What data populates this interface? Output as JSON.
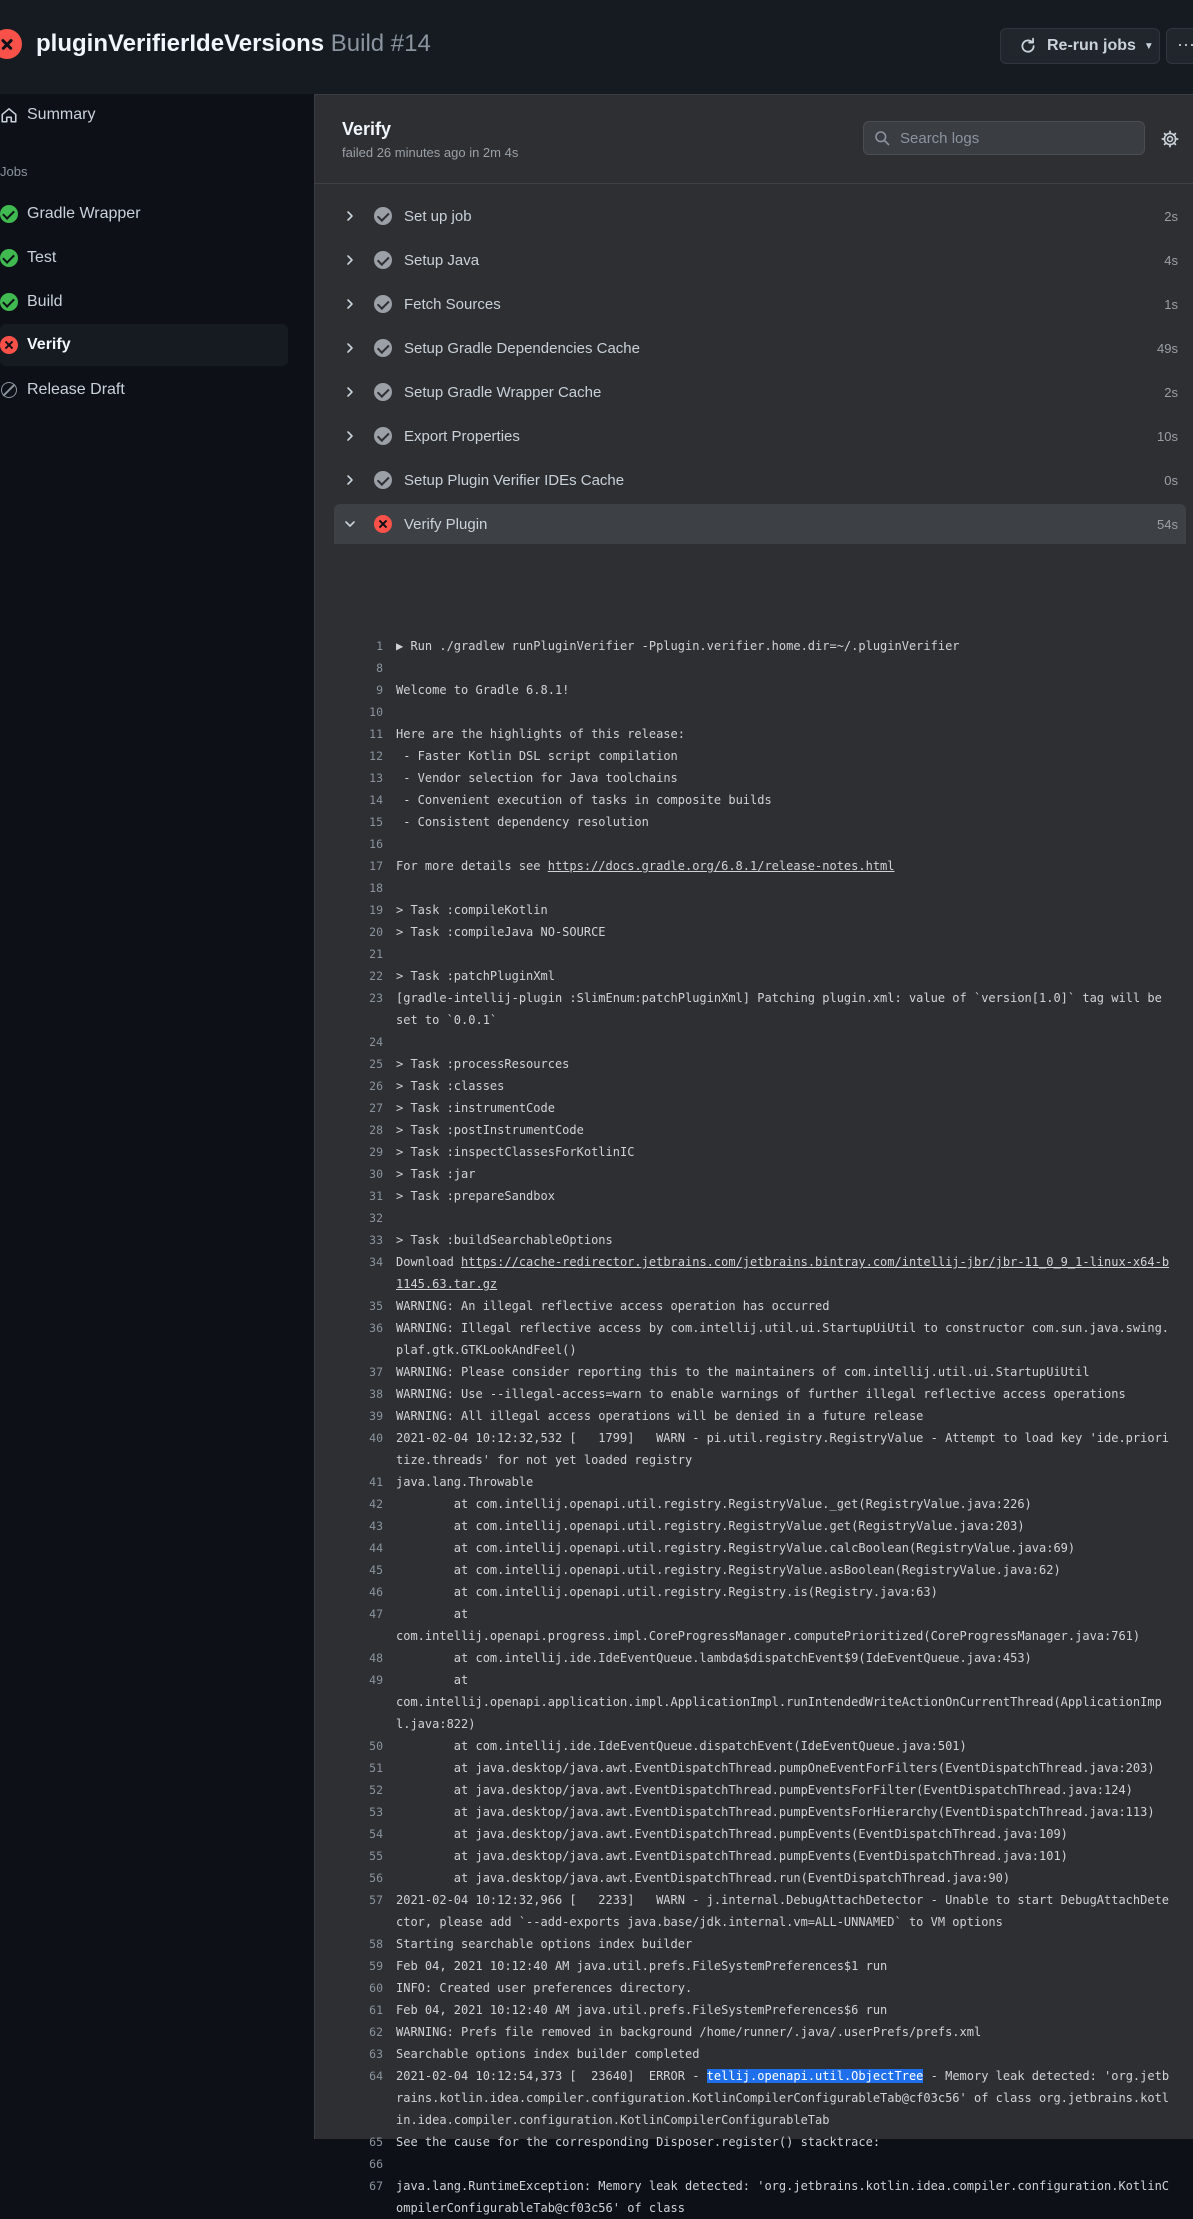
{
  "header": {
    "workflow": "pluginVerifierIdeVersions",
    "build": "Build #14",
    "rerun_label": "Re-run jobs",
    "more_label": "···"
  },
  "sidebar": {
    "summary_label": "Summary",
    "jobs_label": "Jobs",
    "jobs": [
      {
        "label": "Gradle Wrapper",
        "status": "success"
      },
      {
        "label": "Test",
        "status": "success"
      },
      {
        "label": "Build",
        "status": "success"
      },
      {
        "label": "Verify",
        "status": "failure"
      },
      {
        "label": "Release Draft",
        "status": "skipped"
      }
    ]
  },
  "job": {
    "name": "Verify",
    "status_text": "failed 26 minutes ago in 2m 4s",
    "search_placeholder": "Search logs"
  },
  "steps": [
    {
      "name": "Set up job",
      "duration": "2s"
    },
    {
      "name": "Setup Java",
      "duration": "4s"
    },
    {
      "name": "Fetch Sources",
      "duration": "1s"
    },
    {
      "name": "Setup Gradle Dependencies Cache",
      "duration": "49s"
    },
    {
      "name": "Setup Gradle Wrapper Cache",
      "duration": "2s"
    },
    {
      "name": "Export Properties",
      "duration": "10s"
    },
    {
      "name": "Setup Plugin Verifier IDEs Cache",
      "duration": "0s"
    },
    {
      "name": "Verify Plugin",
      "duration": "54s"
    }
  ],
  "log": [
    {
      "n": "1",
      "t": "▶ Run ./gradlew runPluginVerifier -Pplugin.verifier.home.dir=~/.pluginVerifier"
    },
    {
      "n": "8",
      "t": ""
    },
    {
      "n": "9",
      "t": "Welcome to Gradle 6.8.1!"
    },
    {
      "n": "10",
      "t": ""
    },
    {
      "n": "11",
      "t": "Here are the highlights of this release:"
    },
    {
      "n": "12",
      "t": " - Faster Kotlin DSL script compilation"
    },
    {
      "n": "13",
      "t": " - Vendor selection for Java toolchains"
    },
    {
      "n": "14",
      "t": " - Convenient execution of tasks in composite builds"
    },
    {
      "n": "15",
      "t": " - Consistent dependency resolution"
    },
    {
      "n": "16",
      "t": ""
    },
    {
      "n": "17",
      "t": "For more details see ",
      "link": "https://docs.gradle.org/6.8.1/release-notes.html"
    },
    {
      "n": "18",
      "t": ""
    },
    {
      "n": "19",
      "t": "> Task :compileKotlin"
    },
    {
      "n": "20",
      "t": "> Task :compileJava NO-SOURCE"
    },
    {
      "n": "21",
      "t": ""
    },
    {
      "n": "22",
      "t": "> Task :patchPluginXml"
    },
    {
      "n": "23",
      "t": "[gradle-intellij-plugin :SlimEnum:patchPluginXml] Patching plugin.xml: value of `version[1.0]` tag will be set to `0.0.1`"
    },
    {
      "n": "24",
      "t": ""
    },
    {
      "n": "25",
      "t": "> Task :processResources"
    },
    {
      "n": "26",
      "t": "> Task :classes"
    },
    {
      "n": "27",
      "t": "> Task :instrumentCode"
    },
    {
      "n": "28",
      "t": "> Task :postInstrumentCode"
    },
    {
      "n": "29",
      "t": "> Task :inspectClassesForKotlinIC"
    },
    {
      "n": "30",
      "t": "> Task :jar"
    },
    {
      "n": "31",
      "t": "> Task :prepareSandbox"
    },
    {
      "n": "32",
      "t": ""
    },
    {
      "n": "33",
      "t": "> Task :buildSearchableOptions"
    },
    {
      "n": "34",
      "t": "Download ",
      "link": "https://cache-redirector.jetbrains.com/jetbrains.bintray.com/intellij-jbr/jbr-11_0_9_1-linux-x64-b1145.63.tar.gz"
    },
    {
      "n": "35",
      "t": "WARNING: An illegal reflective access operation has occurred"
    },
    {
      "n": "36",
      "t": "WARNING: Illegal reflective access by com.intellij.util.ui.StartupUiUtil to constructor com.sun.java.swing.plaf.gtk.GTKLookAndFeel()"
    },
    {
      "n": "37",
      "t": "WARNING: Please consider reporting this to the maintainers of com.intellij.util.ui.StartupUiUtil"
    },
    {
      "n": "38",
      "t": "WARNING: Use --illegal-access=warn to enable warnings of further illegal reflective access operations"
    },
    {
      "n": "39",
      "t": "WARNING: All illegal access operations will be denied in a future release"
    },
    {
      "n": "40",
      "t": "2021-02-04 10:12:32,532 [   1799]   WARN - pi.util.registry.RegistryValue - Attempt to load key 'ide.prioritize.threads' for not yet loaded registry"
    },
    {
      "n": "41",
      "t": "java.lang.Throwable"
    },
    {
      "n": "42",
      "t": "        at com.intellij.openapi.util.registry.RegistryValue._get(RegistryValue.java:226)"
    },
    {
      "n": "43",
      "t": "        at com.intellij.openapi.util.registry.RegistryValue.get(RegistryValue.java:203)"
    },
    {
      "n": "44",
      "t": "        at com.intellij.openapi.util.registry.RegistryValue.calcBoolean(RegistryValue.java:69)"
    },
    {
      "n": "45",
      "t": "        at com.intellij.openapi.util.registry.RegistryValue.asBoolean(RegistryValue.java:62)"
    },
    {
      "n": "46",
      "t": "        at com.intellij.openapi.util.registry.Registry.is(Registry.java:63)"
    },
    {
      "n": "47",
      "t": "        at\ncom.intellij.openapi.progress.impl.CoreProgressManager.computePrioritized(CoreProgressManager.java:761)"
    },
    {
      "n": "48",
      "t": "        at com.intellij.ide.IdeEventQueue.lambda$dispatchEvent$9(IdeEventQueue.java:453)"
    },
    {
      "n": "49",
      "t": "        at\ncom.intellij.openapi.application.impl.ApplicationImpl.runIntendedWriteActionOnCurrentThread(ApplicationImpl.java:822)"
    },
    {
      "n": "50",
      "t": "        at com.intellij.ide.IdeEventQueue.dispatchEvent(IdeEventQueue.java:501)"
    },
    {
      "n": "51",
      "t": "        at java.desktop/java.awt.EventDispatchThread.pumpOneEventForFilters(EventDispatchThread.java:203)"
    },
    {
      "n": "52",
      "t": "        at java.desktop/java.awt.EventDispatchThread.pumpEventsForFilter(EventDispatchThread.java:124)"
    },
    {
      "n": "53",
      "t": "        at java.desktop/java.awt.EventDispatchThread.pumpEventsForHierarchy(EventDispatchThread.java:113)"
    },
    {
      "n": "54",
      "t": "        at java.desktop/java.awt.EventDispatchThread.pumpEvents(EventDispatchThread.java:109)"
    },
    {
      "n": "55",
      "t": "        at java.desktop/java.awt.EventDispatchThread.pumpEvents(EventDispatchThread.java:101)"
    },
    {
      "n": "56",
      "t": "        at java.desktop/java.awt.EventDispatchThread.run(EventDispatchThread.java:90)"
    },
    {
      "n": "57",
      "t": "2021-02-04 10:12:32,966 [   2233]   WARN - j.internal.DebugAttachDetector - Unable to start DebugAttachDetector, please add `--add-exports java.base/jdk.internal.vm=ALL-UNNAMED` to VM options"
    },
    {
      "n": "58",
      "t": "Starting searchable options index builder"
    },
    {
      "n": "59",
      "t": "Feb 04, 2021 10:12:40 AM java.util.prefs.FileSystemPreferences$1 run"
    },
    {
      "n": "60",
      "t": "INFO: Created user preferences directory."
    },
    {
      "n": "61",
      "t": "Feb 04, 2021 10:12:40 AM java.util.prefs.FileSystemPreferences$6 run"
    },
    {
      "n": "62",
      "t": "WARNING: Prefs file removed in background /home/runner/.java/.userPrefs/prefs.xml"
    },
    {
      "n": "63",
      "t": "Searchable options index builder completed"
    },
    {
      "n": "64",
      "pre": "2021-02-04 10:12:54,373 [  23640]  ERROR - ",
      "hl": "tellij.openapi.util.ObjectTree",
      "t": " - Memory leak detected: 'org.jetbrains.kotlin.idea.compiler.configuration.KotlinCompilerConfigurableTab@cf03c56' of class org.jetbrains.kotlin.idea.compiler.configuration.KotlinCompilerConfigurableTab"
    },
    {
      "n": "65",
      "t": "See the cause for the corresponding Disposer.register() stacktrace:"
    },
    {
      "n": "66",
      "t": ""
    },
    {
      "n": "67",
      "t": "java.lang.RuntimeException: Memory leak detected: 'org.jetbrains.kotlin.idea.compiler.configuration.KotlinCompilerConfigurableTab@cf03c56' of class"
    }
  ]
}
